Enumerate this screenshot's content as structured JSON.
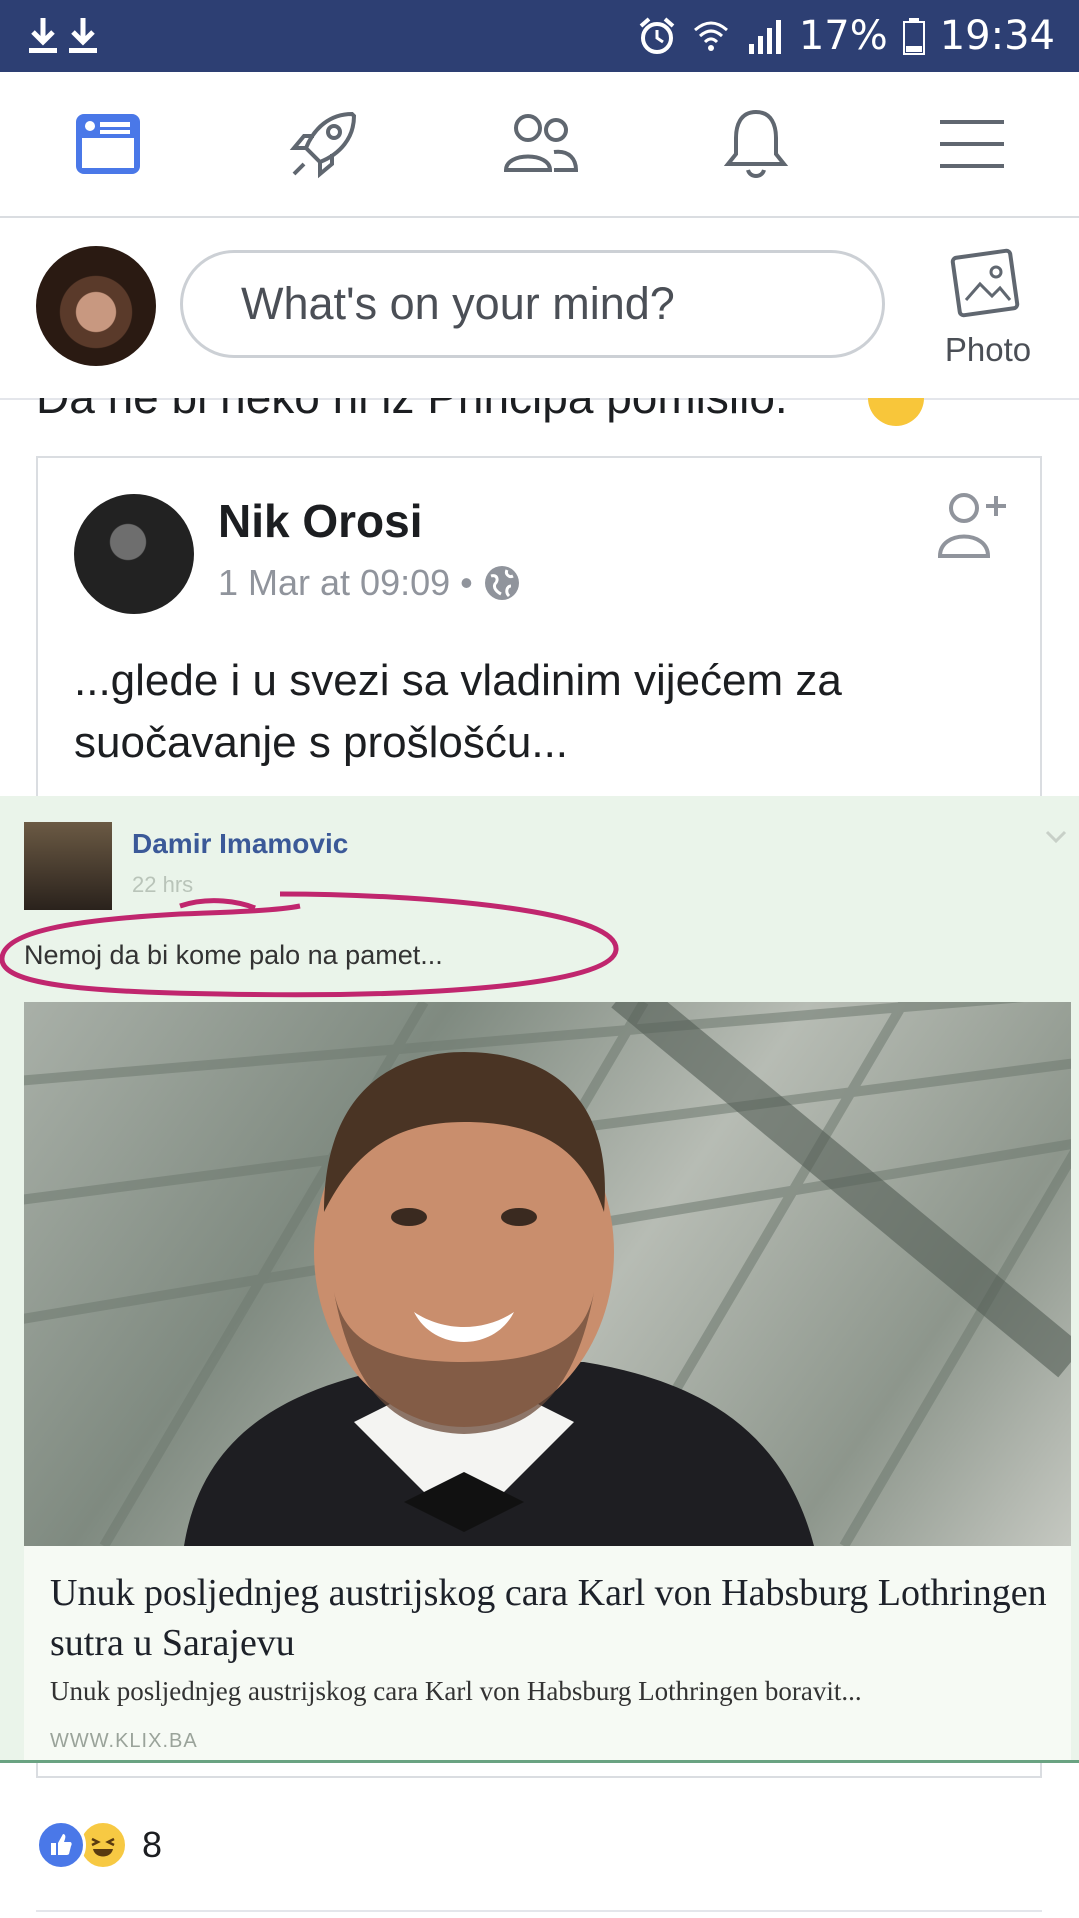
{
  "status_bar": {
    "battery": "17%",
    "time": "19:34"
  },
  "composer": {
    "placeholder": "What's on your mind?",
    "photo_label": "Photo"
  },
  "feed": {
    "cut_off_text": "Da ne bi neko ni iz Principa pomislio."
  },
  "shared_post": {
    "author": "Nik Orosi",
    "timestamp": "1 Mar at 09:09",
    "separator": "•",
    "text": "...glede i u svezi sa vladinim vijećem za suočavanje s prošlošću..."
  },
  "embedded_post": {
    "author": "Damir Imamovic",
    "time": "22 hrs",
    "text": "Nemoj da bi kome palo na pamet...",
    "link_title": "Unuk posljednjeg austrijskog cara Karl von Habsburg Lothringen sutra u Sarajevu",
    "link_description": "Unuk posljednjeg austrijskog cara Karl von Habsburg Lothringen boravit...",
    "link_domain": "WWW.KLIX.BA"
  },
  "reactions": {
    "count": "8",
    "types": [
      "like",
      "haha"
    ]
  },
  "colors": {
    "status_bar": "#2d3f73",
    "accent": "#4a78e8",
    "annotation": "#c0266e"
  }
}
